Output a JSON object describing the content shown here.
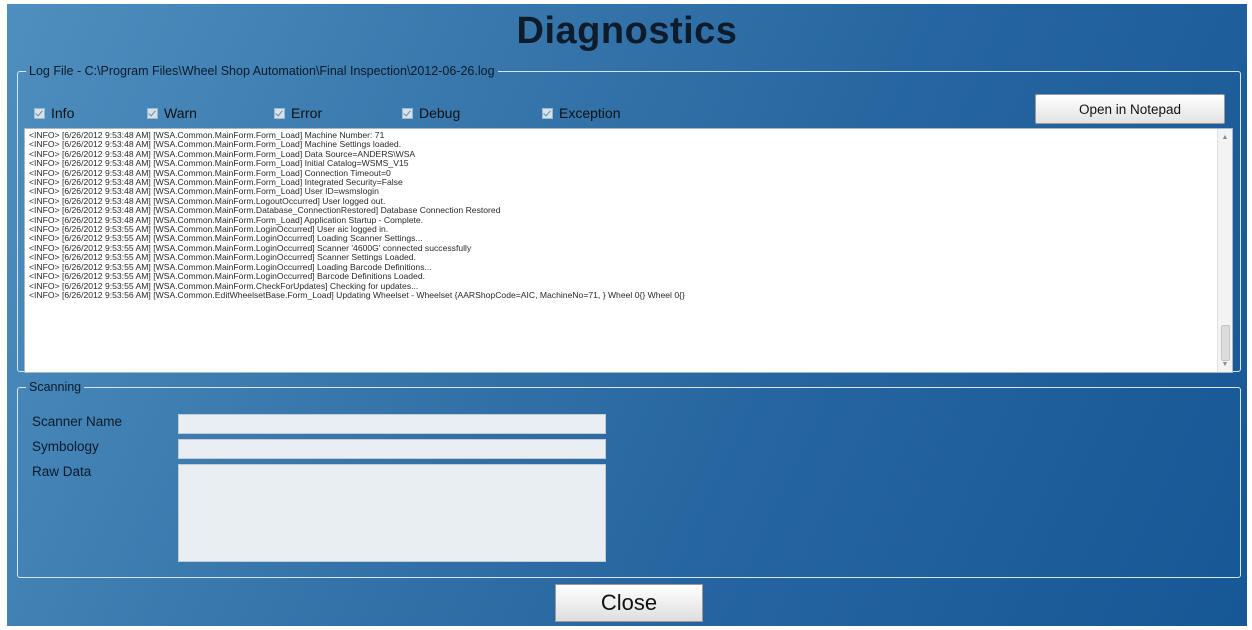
{
  "window": {
    "title": "Diagnostics"
  },
  "log_group": {
    "legend": "Log File - C:\\Program Files\\Wheel Shop Automation\\Final Inspection\\2012-06-26.log",
    "filters": [
      {
        "label": "Info",
        "checked": true
      },
      {
        "label": "Warn",
        "checked": true
      },
      {
        "label": "Error",
        "checked": true
      },
      {
        "label": "Debug",
        "checked": true
      },
      {
        "label": "Exception",
        "checked": true
      }
    ],
    "open_button": "Open in Notepad",
    "lines": [
      "<INFO> [6/26/2012 9:53:48 AM] [WSA.Common.MainForm.Form_Load] Machine Number: 71",
      "<INFO> [6/26/2012 9:53:48 AM] [WSA.Common.MainForm.Form_Load] Machine Settings loaded.",
      "<INFO> [6/26/2012 9:53:48 AM] [WSA.Common.MainForm.Form_Load] Data Source=ANDERS\\WSA",
      "<INFO> [6/26/2012 9:53:48 AM] [WSA.Common.MainForm.Form_Load] Initial Catalog=WSMS_V15",
      "<INFO> [6/26/2012 9:53:48 AM] [WSA.Common.MainForm.Form_Load] Connection Timeout=0",
      "<INFO> [6/26/2012 9:53:48 AM] [WSA.Common.MainForm.Form_Load] Integrated Security=False",
      "<INFO> [6/26/2012 9:53:48 AM] [WSA.Common.MainForm.Form_Load] User ID=wsmslogin",
      "<INFO> [6/26/2012 9:53:48 AM] [WSA.Common.MainForm.LogoutOccurred] User logged out.",
      "<INFO> [6/26/2012 9:53:48 AM] [WSA.Common.MainForm.Database_ConnectionRestored] Database Connection Restored",
      "<INFO> [6/26/2012 9:53:48 AM] [WSA.Common.MainForm.Form_Load] Application Startup - Complete.",
      "<INFO> [6/26/2012 9:53:55 AM] [WSA.Common.MainForm.LoginOccurred] User aic logged in.",
      "<INFO> [6/26/2012 9:53:55 AM] [WSA.Common.MainForm.LoginOccurred] Loading Scanner Settings...",
      "<INFO> [6/26/2012 9:53:55 AM] [WSA.Common.MainForm.LoginOccurred] Scanner '4600G' connected successfully",
      "<INFO> [6/26/2012 9:53:55 AM] [WSA.Common.MainForm.LoginOccurred] Scanner Settings Loaded.",
      "<INFO> [6/26/2012 9:53:55 AM] [WSA.Common.MainForm.LoginOccurred] Loading Barcode Definitions...",
      "<INFO> [6/26/2012 9:53:55 AM] [WSA.Common.MainForm.LoginOccurred] Barcode Definitions Loaded.",
      "<INFO> [6/26/2012 9:53:55 AM] [WSA.Common.MainForm.CheckForUpdates] Checking for updates...",
      "<INFO> [6/26/2012 9:53:56 AM] [WSA.Common.EditWheelsetBase.Form_Load] Updating Wheelset - Wheelset {AARShopCode=AIC, MachineNo=71, }    Wheel 0{}    Wheel 0{}"
    ]
  },
  "scan_group": {
    "legend": "Scanning",
    "scanner_name_label": "Scanner Name",
    "symbology_label": "Symbology",
    "raw_data_label": "Raw Data",
    "scanner_name_value": "",
    "symbology_value": "",
    "raw_data_value": ""
  },
  "close_button": "Close"
}
